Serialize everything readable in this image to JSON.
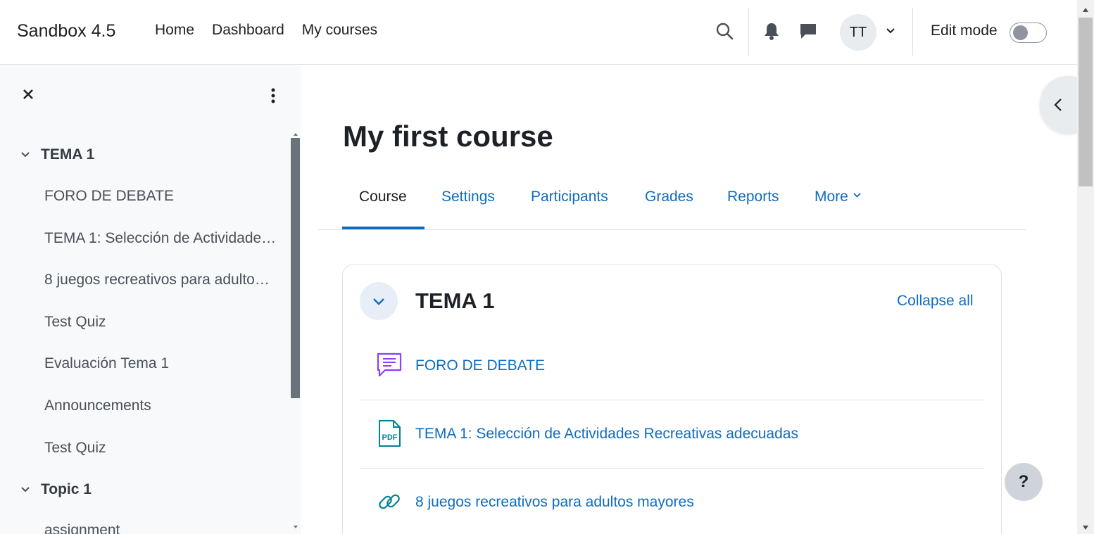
{
  "navbar": {
    "brand": "Sandbox 4.5",
    "links": [
      "Home",
      "Dashboard",
      "My courses"
    ],
    "avatar_initials": "TT",
    "edit_mode_label": "Edit mode",
    "edit_mode_on": false
  },
  "course_index": {
    "sections": [
      {
        "title": "TEMA 1",
        "items": [
          "FORO DE DEBATE",
          "TEMA 1: Selección de Actividades Recreativas adecuadas",
          "8 juegos recreativos para adultos mayores",
          "Test Quiz",
          "Evaluación Tema 1",
          "Announcements",
          "Test Quiz"
        ]
      },
      {
        "title": "Topic 1",
        "items": [
          "assignment"
        ]
      }
    ]
  },
  "page": {
    "title": "My first course"
  },
  "secondary_nav": {
    "tabs": [
      "Course",
      "Settings",
      "Participants",
      "Grades",
      "Reports",
      "More"
    ],
    "active": "Course"
  },
  "course_content": {
    "section_title": "TEMA 1",
    "collapse_all_label": "Collapse all",
    "activities": [
      {
        "name": "FORO DE DEBATE",
        "icon": "forum-icon",
        "color": "#8a3ffc"
      },
      {
        "name": "TEMA 1: Selección de Actividades Recreativas adecuadas",
        "icon": "pdf-file-icon",
        "color": "#008196"
      },
      {
        "name": "8 juegos recreativos para adultos mayores",
        "icon": "url-link-icon",
        "color": "#008196"
      }
    ]
  },
  "help_button_label": "?",
  "colors": {
    "link": "#0f6cbf",
    "text": "#1d2125",
    "drawer_bg": "#f8f9fa",
    "forum_purple": "#8a3ffc",
    "resource_teal": "#008196"
  }
}
